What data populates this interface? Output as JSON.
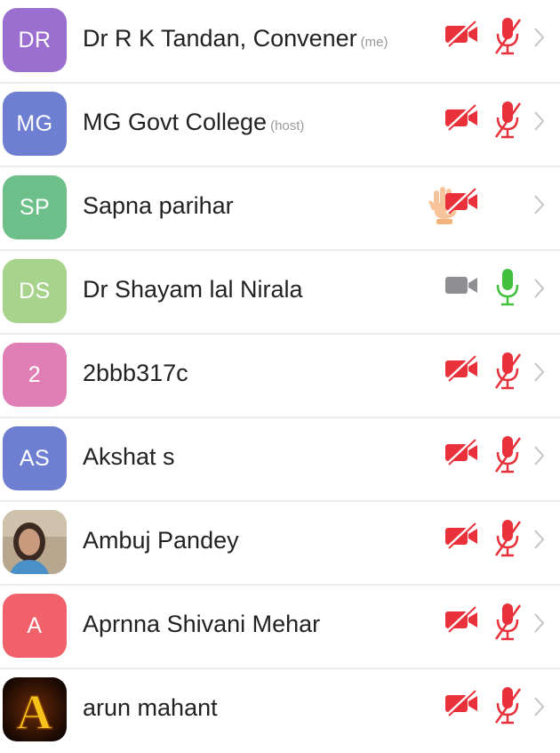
{
  "participants": [
    {
      "initials": "DR",
      "name": "Dr R K Tandan, Convener",
      "tag": "(me)",
      "avatar_color": "#9b6fcf",
      "avatar_type": "initials",
      "video": "off",
      "audio": "muted",
      "hand_raised": false
    },
    {
      "initials": "MG",
      "name": "MG Govt College",
      "tag": "(host)",
      "avatar_color": "#6e7fd2",
      "avatar_type": "initials",
      "video": "off",
      "audio": "muted",
      "hand_raised": false
    },
    {
      "initials": "SP",
      "name": "Sapna parihar",
      "tag": "",
      "avatar_color": "#6ec08a",
      "avatar_type": "initials",
      "video": "off",
      "audio": "none",
      "hand_raised": true
    },
    {
      "initials": "DS",
      "name": "Dr Shayam lal Nirala",
      "tag": "",
      "avatar_color": "#a8d38d",
      "avatar_type": "initials",
      "video": "on",
      "audio": "on",
      "hand_raised": false
    },
    {
      "initials": "2",
      "name": "2bbb317c",
      "tag": "",
      "avatar_color": "#e07fb6",
      "avatar_type": "initials",
      "video": "off",
      "audio": "muted",
      "hand_raised": false
    },
    {
      "initials": "AS",
      "name": "Akshat s",
      "tag": "",
      "avatar_color": "#6e7fd2",
      "avatar_type": "initials",
      "video": "off",
      "audio": "muted",
      "hand_raised": false
    },
    {
      "initials": "",
      "name": "Ambuj Pandey",
      "tag": "",
      "avatar_color": "#b9a58a",
      "avatar_type": "photo-woman",
      "video": "off",
      "audio": "muted",
      "hand_raised": false
    },
    {
      "initials": "A",
      "name": "Aprnna  Shivani Mehar",
      "tag": "",
      "avatar_color": "#f0616a",
      "avatar_type": "initials",
      "video": "off",
      "audio": "muted",
      "hand_raised": false
    },
    {
      "initials": "",
      "name": "arun mahant",
      "tag": "",
      "avatar_color": "#1a0c04",
      "avatar_type": "photo-letter-a",
      "video": "off",
      "audio": "muted",
      "hand_raised": false
    }
  ],
  "colors": {
    "muted_red": "#e8313a",
    "active_green": "#42c03d",
    "camera_gray": "#8e8e93",
    "chevron": "#c4c4c8",
    "hand": "#f6c39a"
  }
}
